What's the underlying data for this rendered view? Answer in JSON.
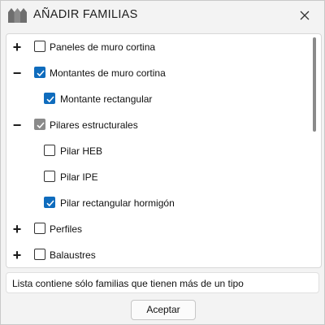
{
  "window": {
    "title": "AÑADIR FAMILIAS",
    "logo_icon": "brand-m-logo",
    "close_icon": "close-icon"
  },
  "tree": {
    "items": [
      {
        "label": "Paneles de muro cortina",
        "expander": "+",
        "checked": false
      },
      {
        "label": "Montantes de muro cortina",
        "expander": "−",
        "checked": true
      },
      {
        "label": "Montante rectangular",
        "expander": "",
        "checked": true
      },
      {
        "label": "Pilares estructurales",
        "expander": "−",
        "checked": true,
        "partial": true
      },
      {
        "label": "Pilar HEB",
        "expander": "",
        "checked": false
      },
      {
        "label": "Pilar IPE",
        "expander": "",
        "checked": false
      },
      {
        "label": "Pilar rectangular hormigón",
        "expander": "",
        "checked": true
      },
      {
        "label": "Perfiles",
        "expander": "+",
        "checked": false
      },
      {
        "label": "Balaustres",
        "expander": "+",
        "checked": false
      }
    ]
  },
  "info": {
    "text": "Lista contiene sólo familias que tienen más de un tipo"
  },
  "footer": {
    "accept_label": "Aceptar"
  },
  "colors": {
    "checked": "#0f6cbd",
    "partial": "#8a8a8a",
    "logo": "#6e6e6e"
  }
}
